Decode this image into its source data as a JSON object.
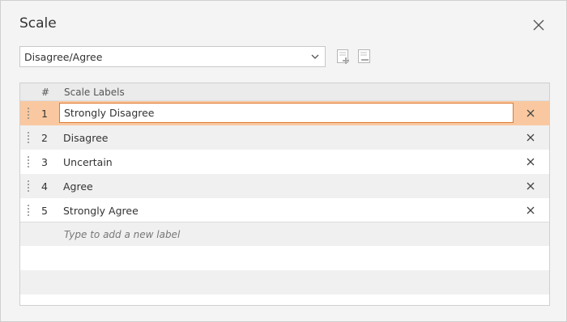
{
  "dialog": {
    "title": "Scale"
  },
  "scale_select": {
    "value": "Disagree/Agree"
  },
  "toolbar": {
    "add_icon": "add-scale-icon",
    "remove_icon": "remove-scale-icon"
  },
  "grid": {
    "header": {
      "number": "#",
      "labels": "Scale Labels"
    },
    "rows": [
      {
        "number": "1",
        "label": "Strongly Disagree"
      },
      {
        "number": "2",
        "label": "Disagree"
      },
      {
        "number": "3",
        "label": "Uncertain"
      },
      {
        "number": "4",
        "label": "Agree"
      },
      {
        "number": "5",
        "label": "Strongly Agree"
      }
    ],
    "add_placeholder": "Type to add a new label"
  },
  "colors": {
    "active_row": "#f9c8a0",
    "active_border": "#e07a2e"
  }
}
